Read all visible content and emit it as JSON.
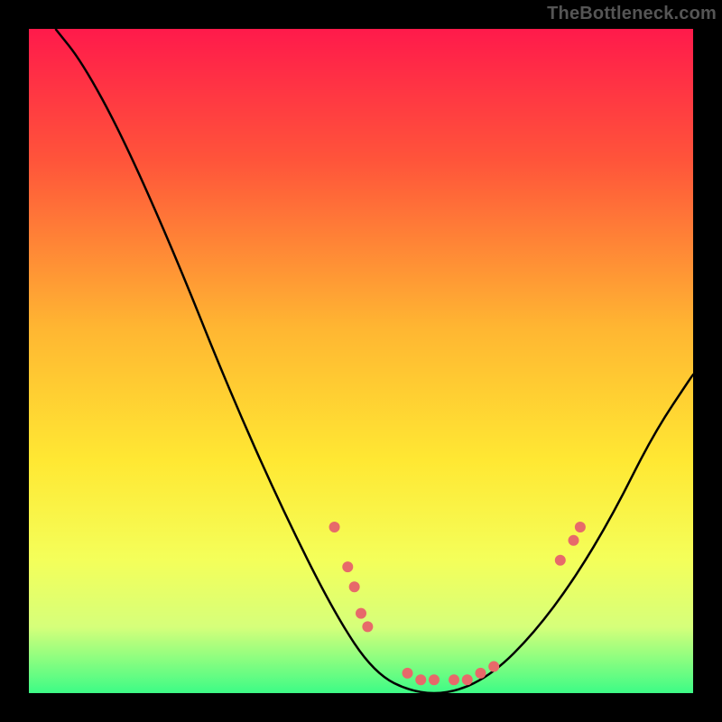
{
  "watermark": "TheBottleneck.com",
  "chart_data": {
    "type": "line",
    "title": "",
    "xlabel": "",
    "ylabel": "",
    "xlim": [
      0,
      100
    ],
    "ylim": [
      0,
      100
    ],
    "gradient_stops": [
      {
        "offset": 0,
        "color": "#ff1a4b"
      },
      {
        "offset": 20,
        "color": "#ff553a"
      },
      {
        "offset": 45,
        "color": "#ffb632"
      },
      {
        "offset": 65,
        "color": "#ffe833"
      },
      {
        "offset": 80,
        "color": "#f4ff5a"
      },
      {
        "offset": 90,
        "color": "#d6ff7a"
      },
      {
        "offset": 100,
        "color": "#3dfc86"
      }
    ],
    "series": [
      {
        "name": "curve",
        "color": "#000000",
        "points": [
          {
            "x": 4,
            "y": 100
          },
          {
            "x": 8,
            "y": 95
          },
          {
            "x": 14,
            "y": 84
          },
          {
            "x": 22,
            "y": 66
          },
          {
            "x": 30,
            "y": 46
          },
          {
            "x": 38,
            "y": 28
          },
          {
            "x": 46,
            "y": 12
          },
          {
            "x": 52,
            "y": 3
          },
          {
            "x": 58,
            "y": 0
          },
          {
            "x": 64,
            "y": 0
          },
          {
            "x": 70,
            "y": 3
          },
          {
            "x": 76,
            "y": 9
          },
          {
            "x": 82,
            "y": 17
          },
          {
            "x": 88,
            "y": 27
          },
          {
            "x": 94,
            "y": 39
          },
          {
            "x": 100,
            "y": 48
          }
        ]
      }
    ],
    "markers": {
      "name": "dots",
      "color": "#e76a6a",
      "radius": 6,
      "points": [
        {
          "x": 46,
          "y": 25
        },
        {
          "x": 48,
          "y": 19
        },
        {
          "x": 49,
          "y": 16
        },
        {
          "x": 50,
          "y": 12
        },
        {
          "x": 51,
          "y": 10
        },
        {
          "x": 57,
          "y": 3
        },
        {
          "x": 59,
          "y": 2
        },
        {
          "x": 61,
          "y": 2
        },
        {
          "x": 64,
          "y": 2
        },
        {
          "x": 66,
          "y": 2
        },
        {
          "x": 68,
          "y": 3
        },
        {
          "x": 70,
          "y": 4
        },
        {
          "x": 80,
          "y": 20
        },
        {
          "x": 82,
          "y": 23
        },
        {
          "x": 83,
          "y": 25
        }
      ]
    }
  }
}
